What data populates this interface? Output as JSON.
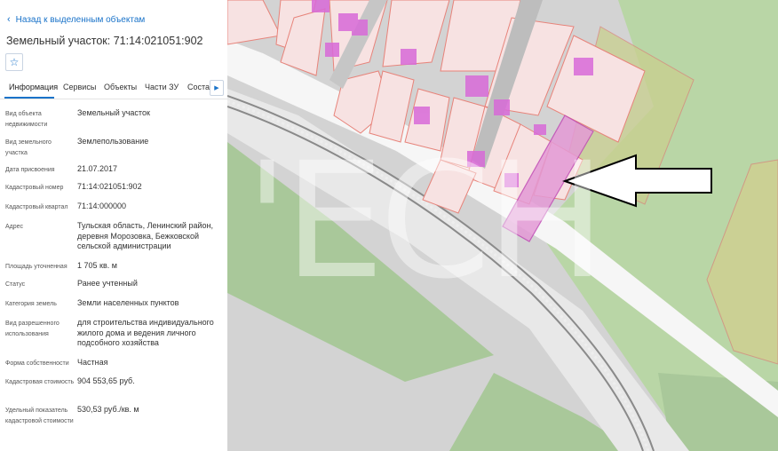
{
  "panel": {
    "back_label": "Назад к выделенным объектам",
    "title": "Земельный участок: 71:14:021051:902",
    "tabs": [
      {
        "label": "Информация"
      },
      {
        "label": "Сервисы"
      },
      {
        "label": "Объекты"
      },
      {
        "label": "Части ЗУ"
      },
      {
        "label": "Состав"
      }
    ],
    "rows": [
      {
        "label": "Вид объекта недвижимости",
        "value": "Земельный участок"
      },
      {
        "label": "Вид земельного участка",
        "value": "Землепользование"
      },
      {
        "label": "Дата присвоения",
        "value": "21.07.2017"
      },
      {
        "label": "Кадастровый номер",
        "value": "71:14:021051:902"
      },
      {
        "label": "Кадастровый квартал",
        "value": "71:14:000000"
      },
      {
        "label": "Адрес",
        "value": "Тульская область, Ленинский район, деревня Морозовка, Бежковской сельской администрации"
      },
      {
        "label": "Площадь уточненная",
        "value": "1 705 кв. м"
      },
      {
        "label": "Статус",
        "value": "Ранее учтенный"
      },
      {
        "label": "Категория земель",
        "value": "Земли населенных пунктов"
      },
      {
        "label": "Вид разрешенного использования",
        "value": "для строительства индивидуального жилого дома и ведения личного подсобного хозяйства"
      },
      {
        "label": "Форма собственности",
        "value": "Частная"
      },
      {
        "label": "Кадастровая стоимость",
        "value": "904 553,65 руб."
      },
      {
        "label": "Удельный показатель кадастровой стоимости",
        "value": "530,53 руб./кв. м"
      }
    ]
  },
  "map": {
    "watermark": "'ЕСН",
    "colors": {
      "background": "#d3d3d3",
      "green": "#a9c89a",
      "light_green": "#c4dfa8",
      "road": "#f4f4f4",
      "parcel_fill": "#f6e3e3",
      "parcel_stroke": "#e7837a",
      "building": "#d86ad8",
      "highlight": "#e49ad6",
      "accent": "#1a73c9"
    },
    "icons": [
      "star-icon",
      "chevron-left-icon",
      "chevron-right-icon",
      "arrow-icon"
    ]
  }
}
